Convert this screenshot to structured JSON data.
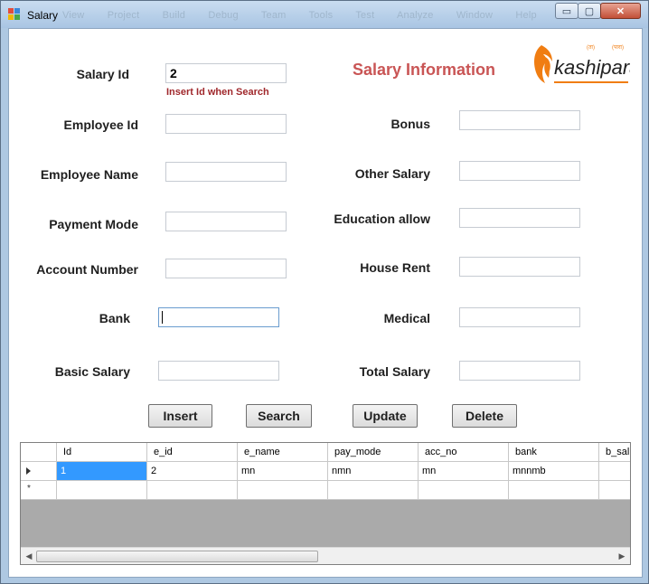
{
  "window": {
    "title": "Salary",
    "faded_menu": [
      "View",
      "Project",
      "Build",
      "Debug",
      "Team",
      "Tools",
      "Test",
      "Analyze",
      "Window",
      "Help"
    ],
    "controls": {
      "minimize": "▭",
      "maximize": "▢",
      "close": "✕"
    }
  },
  "heading": "Salary Information",
  "logo": {
    "text": "kashipara",
    "small_left": "(ता)",
    "small_right": "(पारा)"
  },
  "form": {
    "salary_id": {
      "label": "Salary Id",
      "value": "2",
      "hint": "Insert  Id when Search"
    },
    "employee_id": {
      "label": "Employee Id",
      "value": ""
    },
    "employee_name": {
      "label": "Employee Name",
      "value": ""
    },
    "payment_mode": {
      "label": "Payment Mode",
      "value": ""
    },
    "account_number": {
      "label": "Account Number",
      "value": ""
    },
    "bank": {
      "label": "Bank",
      "value": ""
    },
    "basic_salary": {
      "label": "Basic Salary",
      "value": ""
    },
    "bonus": {
      "label": "Bonus",
      "value": ""
    },
    "other_salary": {
      "label": "Other Salary",
      "value": ""
    },
    "education_allow": {
      "label": "Education allow",
      "value": ""
    },
    "house_rent": {
      "label": "House Rent",
      "value": ""
    },
    "medical": {
      "label": "Medical",
      "value": ""
    },
    "total_salary": {
      "label": "Total Salary",
      "value": ""
    }
  },
  "buttons": {
    "insert": "Insert",
    "search": "Search",
    "update": "Update",
    "delete": "Delete"
  },
  "grid": {
    "columns": [
      "Id",
      "e_id",
      "e_name",
      "pay_mode",
      "acc_no",
      "bank",
      "b_sal"
    ],
    "rows": [
      [
        "1",
        "2",
        "mn",
        "nmn",
        "mn",
        "mnnmb",
        ""
      ]
    ],
    "new_row_marker": "*"
  },
  "colors": {
    "heading": "#c95555",
    "hint": "#a0282c",
    "selection": "#3399ff",
    "logo": "#f07d12"
  }
}
